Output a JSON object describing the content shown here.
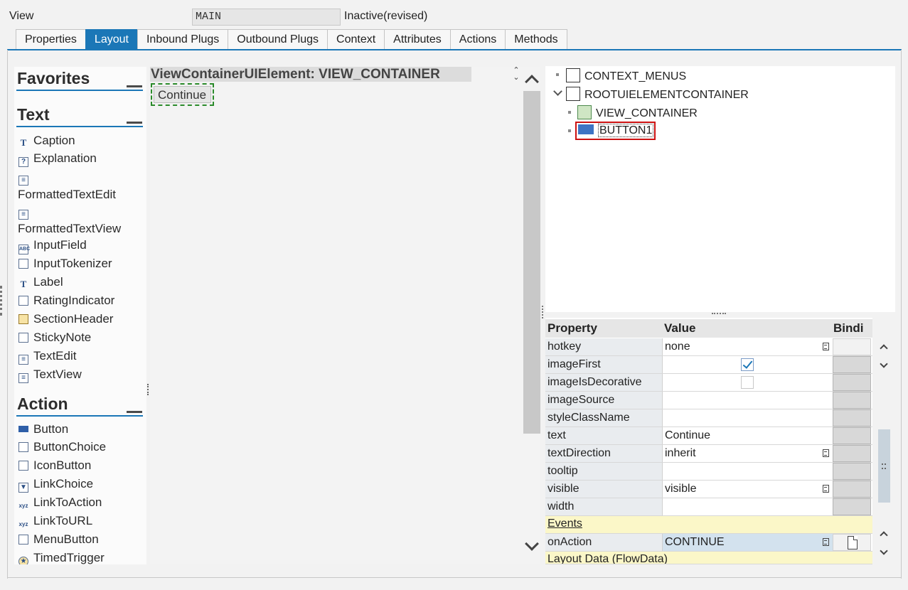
{
  "header": {
    "view_label": "View",
    "view_name": "MAIN",
    "status": "Inactive(revised)"
  },
  "tabs": [
    {
      "label": "Properties",
      "active": false
    },
    {
      "label": "Layout",
      "active": true
    },
    {
      "label": "Inbound Plugs",
      "active": false
    },
    {
      "label": "Outbound Plugs",
      "active": false
    },
    {
      "label": "Context",
      "active": false
    },
    {
      "label": "Attributes",
      "active": false
    },
    {
      "label": "Actions",
      "active": false
    },
    {
      "label": "Methods",
      "active": false
    }
  ],
  "palette": {
    "favorites_title": "Favorites",
    "text_title": "Text",
    "text_items": [
      "Caption",
      "Explanation",
      "FormattedTextEdit",
      "FormattedTextView",
      "InputField",
      "InputTokenizer",
      "Label",
      "RatingIndicator",
      "SectionHeader",
      "StickyNote",
      "TextEdit",
      "TextView"
    ],
    "action_title": "Action",
    "action_items": [
      "Button",
      "ButtonChoice",
      "IconButton",
      "LinkChoice",
      "LinkToAction",
      "LinkToURL",
      "MenuButton",
      "TimedTrigger"
    ]
  },
  "canvas": {
    "title": "ViewContainerUIElement: VIEW_CONTAINER",
    "button_text": "Continue"
  },
  "tree": {
    "nodes": [
      "CONTEXT_MENUS",
      "ROOTUIELEMENTCONTAINER",
      "VIEW_CONTAINER",
      "BUTTON1"
    ]
  },
  "properties": {
    "col_property": "Property",
    "col_value": "Value",
    "col_binding": "Bindi",
    "rows": [
      {
        "name": "hotkey",
        "value": "none"
      },
      {
        "name": "imageFirst",
        "value": "",
        "checked": true
      },
      {
        "name": "imageIsDecorative",
        "value": "",
        "checked": false
      },
      {
        "name": "imageSource",
        "value": ""
      },
      {
        "name": "styleClassName",
        "value": ""
      },
      {
        "name": "text",
        "value": "Continue"
      },
      {
        "name": "textDirection",
        "value": "inherit"
      },
      {
        "name": "tooltip",
        "value": ""
      },
      {
        "name": "visible",
        "value": "visible"
      },
      {
        "name": "width",
        "value": ""
      }
    ],
    "events_section": "Events",
    "event_rows": [
      {
        "name": "onAction",
        "value": "CONTINUE"
      }
    ],
    "layout_section": "Layout Data (FlowData)"
  },
  "colors": {
    "accent": "#1b77b7",
    "selection_red": "#cc1111",
    "drop_green": "#2a8a2a",
    "section_yellow": "#fbf7c8"
  }
}
